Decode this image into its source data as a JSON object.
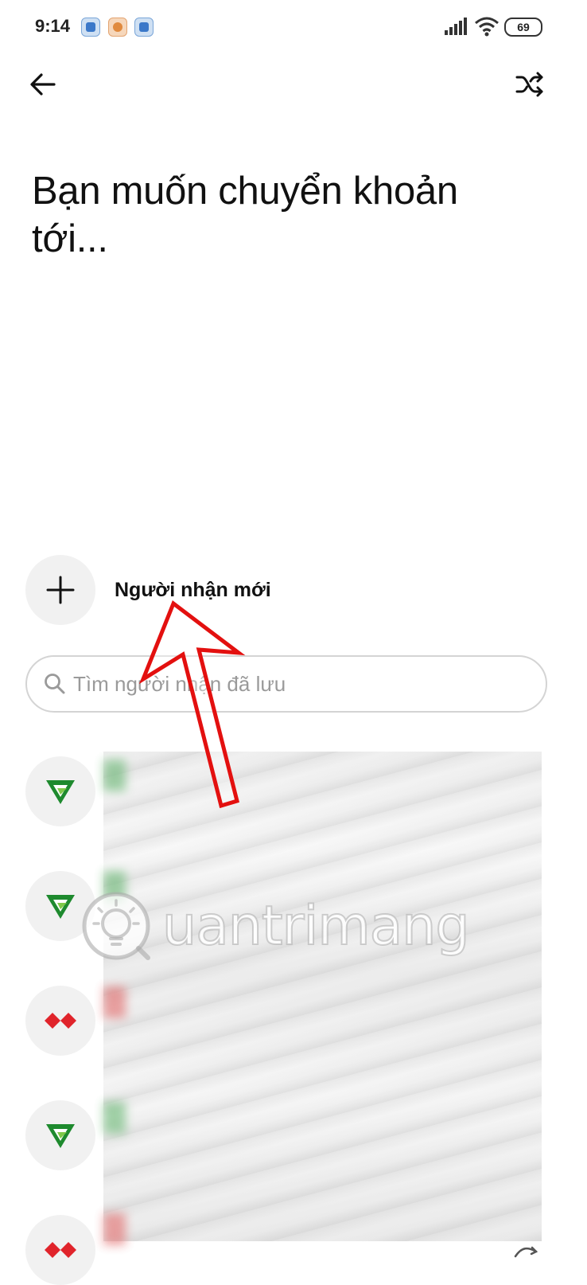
{
  "status_bar": {
    "time": "9:14",
    "battery": "69"
  },
  "header": {
    "title": "Bạn muốn chuyển khoản tới..."
  },
  "new_recipient": {
    "label": "Người nhận mới"
  },
  "search": {
    "placeholder": "Tìm người nhận đã lưu"
  },
  "watermark": {
    "text": "uantrimang"
  },
  "contacts": [
    {
      "bank_icon": "vietcombank-logo-icon"
    },
    {
      "bank_icon": "vietcombank-logo-icon"
    },
    {
      "bank_icon": "techcombank-logo-icon"
    },
    {
      "bank_icon": "vietcombank-logo-icon"
    },
    {
      "bank_icon": "techcombank-logo-icon"
    }
  ],
  "colors": {
    "vietcombank_green": "#1e8a2e",
    "techcombank_red": "#e0242b",
    "annotation_red": "#e3100f"
  }
}
